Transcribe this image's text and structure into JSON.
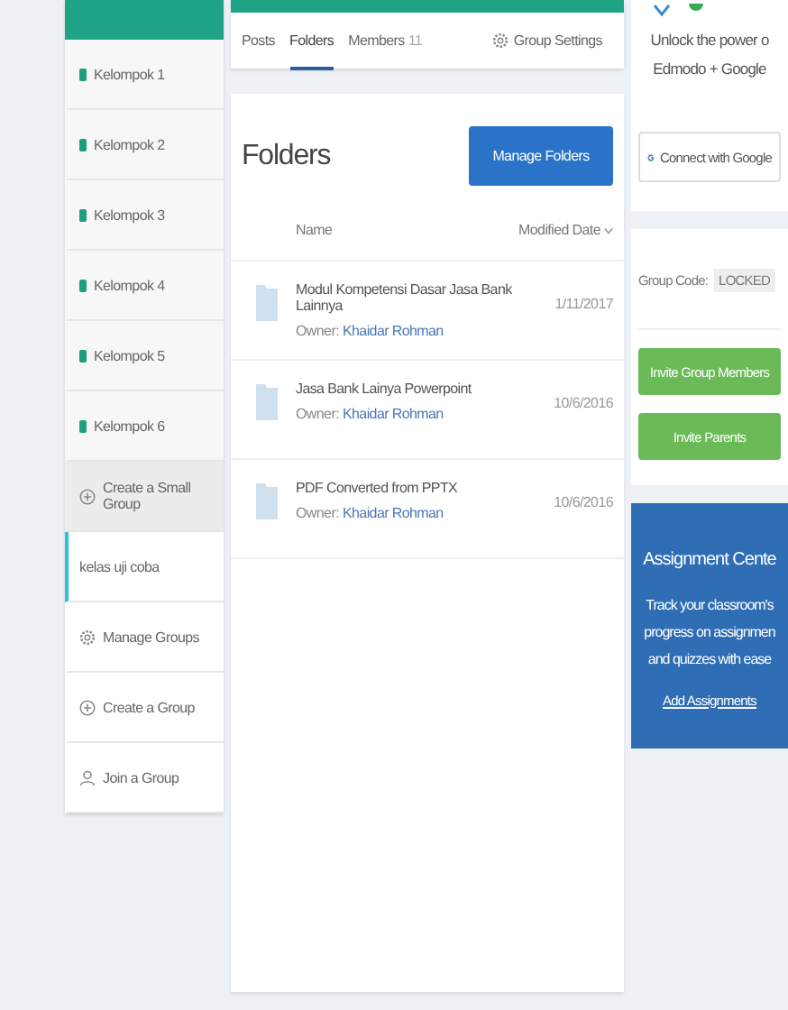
{
  "sidebar": {
    "items": [
      {
        "kind": "subgroup",
        "label": "Kelompok 1",
        "color": "#1e9e7e",
        "selected": false
      },
      {
        "kind": "subgroup",
        "label": "Kelompok 2",
        "color": "#1e9e7e",
        "selected": false
      },
      {
        "kind": "subgroup",
        "label": "Kelompok 3",
        "color": "#1e9e7e",
        "selected": false
      },
      {
        "kind": "subgroup",
        "label": "Kelompok 4",
        "color": "#1e9e7e",
        "selected": false
      },
      {
        "kind": "subgroup",
        "label": "Kelompok 5",
        "color": "#1e9e7e",
        "selected": false
      },
      {
        "kind": "subgroup",
        "label": "Kelompok 6",
        "color": "#1e9e7e",
        "selected": false
      },
      {
        "kind": "create-small",
        "label": "Create a Small Group",
        "selected": false
      },
      {
        "kind": "group",
        "label": "kelas uji coba",
        "selected": true
      },
      {
        "kind": "manage",
        "label": "Manage Groups",
        "selected": false
      },
      {
        "kind": "create",
        "label": "Create a Group",
        "selected": false
      },
      {
        "kind": "join",
        "label": "Join a Group",
        "selected": false
      }
    ]
  },
  "tabs": [
    {
      "label": "Posts",
      "selected": false
    },
    {
      "label": "Folders",
      "selected": true
    },
    {
      "label": "Members",
      "count": "11",
      "selected": false
    }
  ],
  "group_settings": "Group Settings",
  "folders": {
    "title": "Folders",
    "manage_button": "Manage Folders",
    "columns": [
      "Name",
      "Modified Date"
    ],
    "rows": [
      {
        "name": "Modul Kompetensi Dasar Jasa Bank Lainnya",
        "owner_label": "Owner:",
        "owner": "Khaidar Rohman",
        "date": "1/11/2017"
      },
      {
        "name": "Jasa Bank Lainya Powerpoint",
        "owner_label": "Owner:",
        "owner": "Khaidar Rohman",
        "date": "10/6/2016"
      },
      {
        "name": "PDF Converted from PPTX",
        "owner_label": "Owner:",
        "owner": "Khaidar Rohman",
        "date": "10/6/2016"
      }
    ]
  },
  "promo": {
    "text": "Unlock the power o",
    "text2": "Edmodo + Google",
    "button": "Connect with Google"
  },
  "group_code": {
    "label": "Group Code:",
    "value": "LOCKED"
  },
  "invite_buttons": [
    "Invite Group Members",
    "Invite Parents"
  ],
  "assignment": {
    "title": "Assignment Cente",
    "lines": [
      "Track your classroom's",
      "progress on assignmen",
      "and quizzes with ease"
    ],
    "link": "Add Assignments"
  }
}
